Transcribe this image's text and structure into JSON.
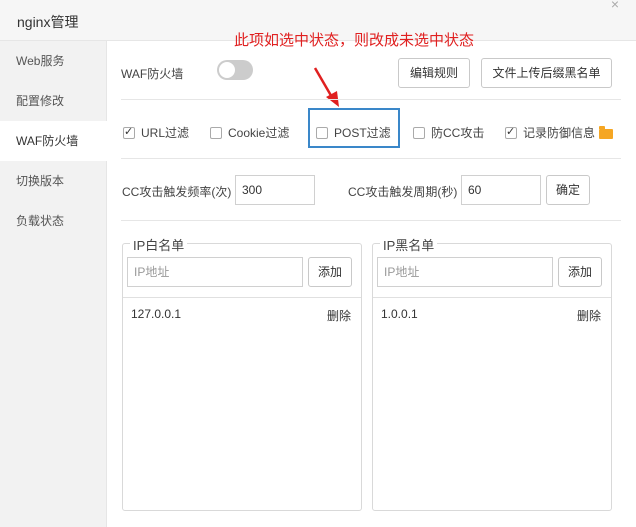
{
  "window": {
    "title": "nginx管理",
    "close": "×"
  },
  "sidebar": {
    "items": [
      {
        "label": "Web服务"
      },
      {
        "label": "配置修改"
      },
      {
        "label": "WAF防火墙",
        "active": true
      },
      {
        "label": "切换版本"
      },
      {
        "label": "负载状态"
      }
    ]
  },
  "annotation": {
    "text": "此项如选中状态，则改成未选中状态",
    "color": "#e02020"
  },
  "waf": {
    "label": "WAF防火墙",
    "enabled": false,
    "edit_rules_button": "编辑规则",
    "upload_blacklist_button": "文件上传后缀黑名单"
  },
  "filters": [
    {
      "label": "URL过滤",
      "checked": true
    },
    {
      "label": "Cookie过滤",
      "checked": false
    },
    {
      "label": "POST过滤",
      "checked": false
    },
    {
      "label": "防CC攻击",
      "checked": false
    },
    {
      "label": "记录防御信息",
      "checked": true,
      "icon": "folder-icon"
    }
  ],
  "cc": {
    "frequency_label": "CC攻击触发频率(次)",
    "frequency_value": "300",
    "period_label": "CC攻击触发周期(秒)",
    "period_value": "60",
    "confirm_button": "确定"
  },
  "whitelist": {
    "title": "IP白名单",
    "placeholder": "IP地址",
    "add_button": "添加",
    "entries": [
      {
        "ip": "127.0.0.1",
        "action": "删除"
      }
    ]
  },
  "blacklist": {
    "title": "IP黑名单",
    "placeholder": "IP地址",
    "add_button": "添加",
    "entries": [
      {
        "ip": "1.0.0.1",
        "action": "删除"
      }
    ]
  },
  "colors": {
    "highlight_border": "#3a87c9",
    "folder": "#f5a623"
  }
}
